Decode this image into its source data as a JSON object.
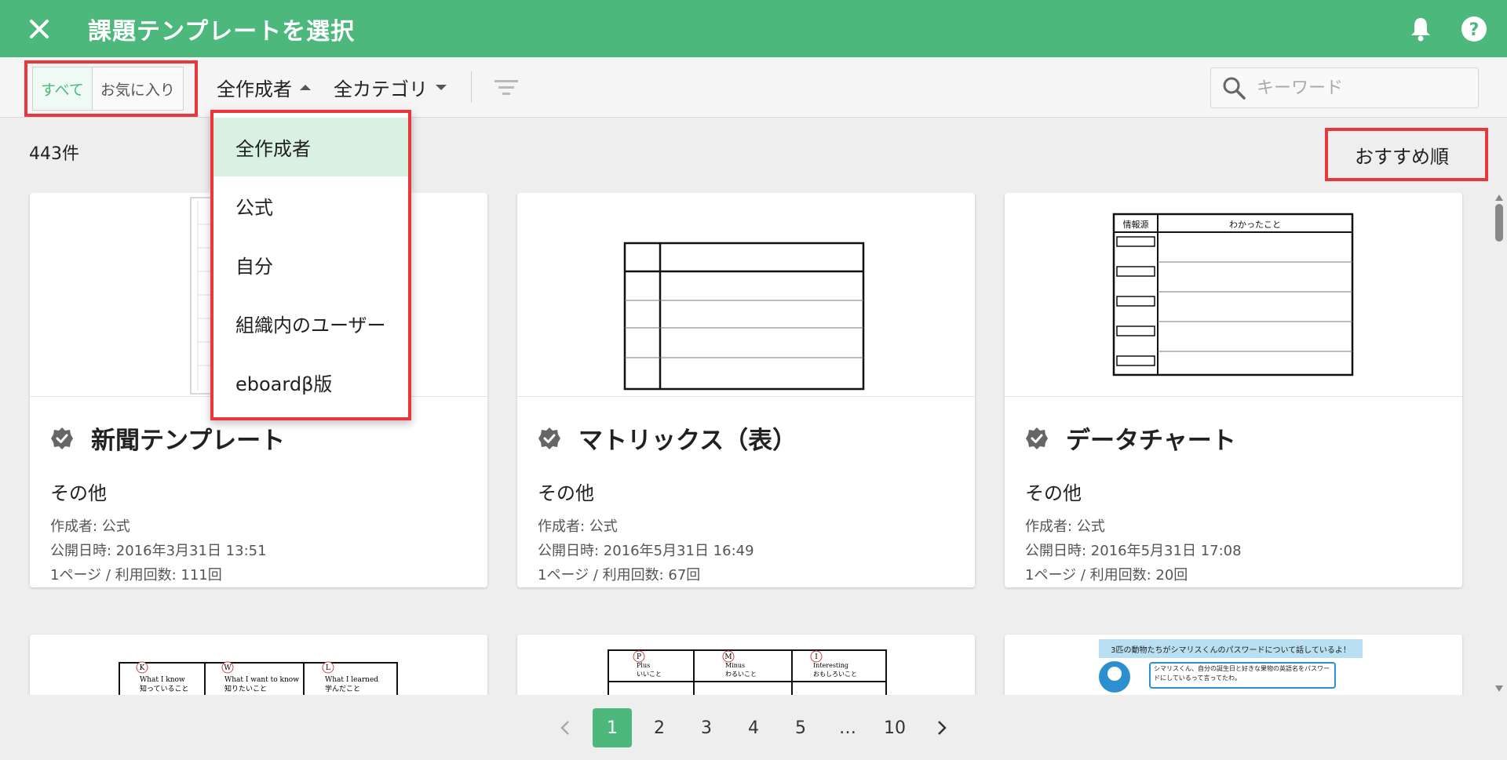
{
  "header": {
    "title": "課題テンプレートを選択"
  },
  "toolbar": {
    "segments": [
      "すべて",
      "お気に入り"
    ],
    "creator_filter": "全作成者",
    "category_filter": "全カテゴリ",
    "search_placeholder": "キーワード"
  },
  "results": {
    "count": "443件",
    "sort": "おすすめ順"
  },
  "creator_menu": {
    "items": [
      "全作成者",
      "公式",
      "自分",
      "組織内のユーザー",
      "eboardβ版"
    ],
    "selected": "全作成者"
  },
  "cards": [
    {
      "title": "新聞テンプレート",
      "category": "その他",
      "author": "作成者: 公式",
      "published": "公開日時: 2016年3月31日 13:51",
      "usage": "1ページ / 利用回数: 111回"
    },
    {
      "title": "マトリックス（表）",
      "category": "その他",
      "author": "作成者: 公式",
      "published": "公開日時: 2016年5月31日 16:49",
      "usage": "1ページ / 利用回数: 67回"
    },
    {
      "title": "データチャート",
      "category": "その他",
      "author": "作成者: 公式",
      "published": "公開日時: 2016年5月31日 17:08",
      "usage": "1ページ / 利用回数: 20回"
    }
  ],
  "thumbs": {
    "datachart_header_left": "情報源",
    "datachart_header_right": "わかったこと",
    "kwl": [
      {
        "letter": "K",
        "en": "What I know",
        "jp": "知っていること"
      },
      {
        "letter": "W",
        "en": "What I want to know",
        "jp": "知りたいこと"
      },
      {
        "letter": "L",
        "en": "What I learned",
        "jp": "学んだこと"
      }
    ],
    "pmi": [
      {
        "letter": "P",
        "en": "Plus",
        "jp": "いいこと"
      },
      {
        "letter": "M",
        "en": "Minus",
        "jp": "わるいこと"
      },
      {
        "letter": "I",
        "en": "Interesting",
        "jp": "おもしろいこと"
      }
    ],
    "password_title": "3匹の動物たちがシマリスくんのパスワードについて話しているよ！",
    "password_bubble": "シマリスくん、自分の誕生日と好きな果物の英語名をパスワードにしているって言ってたわ。"
  },
  "pagination": {
    "pages": [
      "1",
      "2",
      "3",
      "4",
      "5",
      "…",
      "10"
    ],
    "current": "1"
  },
  "colors": {
    "brand": "#4cb87c",
    "highlight": "#e8383d",
    "menu_selected": "#d9f1e3"
  }
}
